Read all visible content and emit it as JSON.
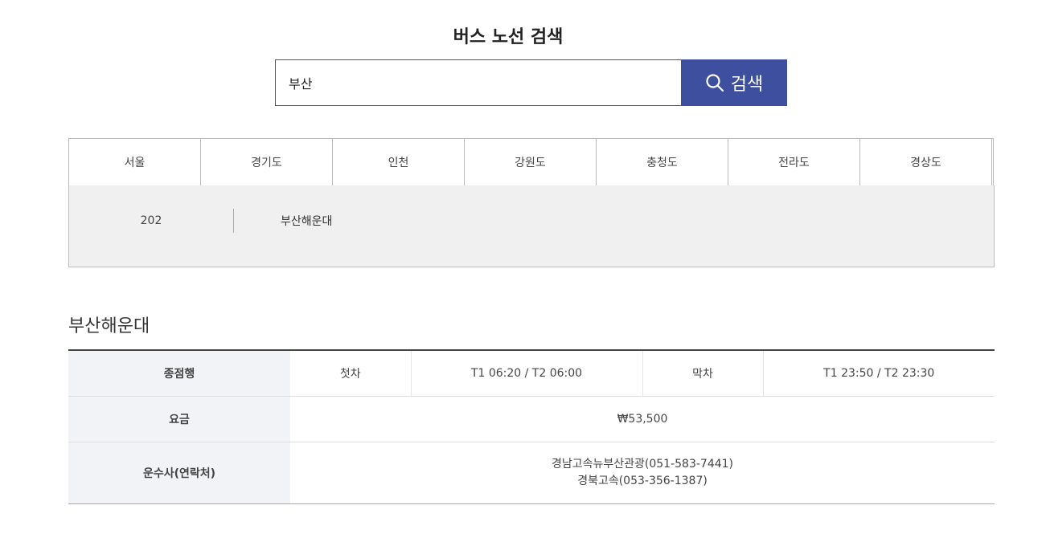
{
  "page": {
    "title": "버스 노선 검색"
  },
  "search": {
    "value": "부산",
    "button_label": "검색"
  },
  "regions": [
    "서울",
    "경기도",
    "인천",
    "강원도",
    "충청도",
    "전라도",
    "경상도"
  ],
  "routes": [
    {
      "number": "202",
      "name": "부산해운대"
    }
  ],
  "detail": {
    "title": "부산해운대",
    "terminal_label": "종점행",
    "first_label": "첫차",
    "first_time": "T1 06:20 / T2 06:00",
    "last_label": "막차",
    "last_time": "T1 23:50 / T2 23:30",
    "fare_label": "요금",
    "fare_value": "₩53,500",
    "operator_label": "운수사(연락처)",
    "operators": [
      "경남고속뉴부산관광(051-583-7441)",
      "경북고속(053-356-1387)"
    ]
  },
  "colors": {
    "accent": "#3f4fa0",
    "panel_bg": "#f0f0f0",
    "row_head_bg": "#f2f3f7"
  },
  "icons": {
    "search": "search-icon"
  }
}
